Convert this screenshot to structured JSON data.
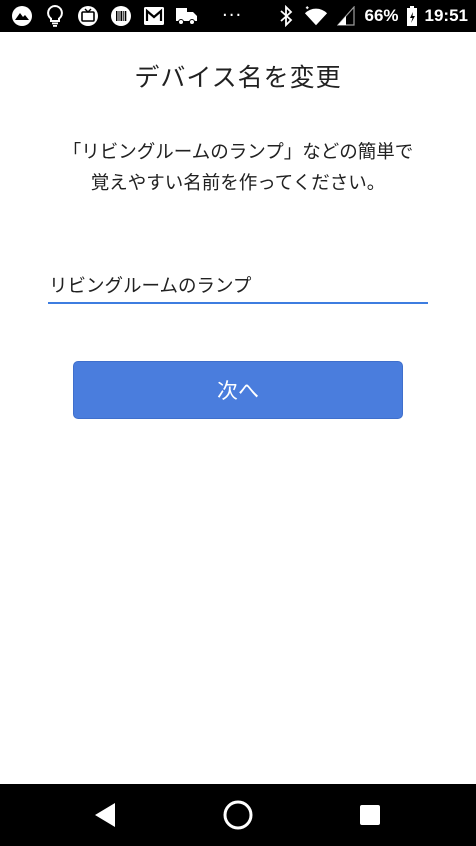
{
  "status_bar": {
    "battery_percent": "66%",
    "time": "19:51",
    "overflow": "···",
    "icons_left": [
      "mountain-icon",
      "lightbulb-icon",
      "tv-icon",
      "barcode-icon",
      "mail-icon",
      "car-icon"
    ],
    "icons_right": [
      "bluetooth-icon",
      "wifi-icon",
      "signal-icon",
      "battery-icon"
    ]
  },
  "page": {
    "title": "デバイス名を変更",
    "description_line1": "「リビングルームのランプ」などの簡単で",
    "description_line2": "覚えやすい名前を作ってください。",
    "input_value": "リビングルームのランプ",
    "next_button": "次へ"
  },
  "nav_bar": {
    "icons": [
      "back-icon",
      "home-icon",
      "recents-icon"
    ]
  },
  "colors": {
    "accent": "#4a7ddd",
    "underline": "#3d7de0",
    "text": "#212121"
  }
}
